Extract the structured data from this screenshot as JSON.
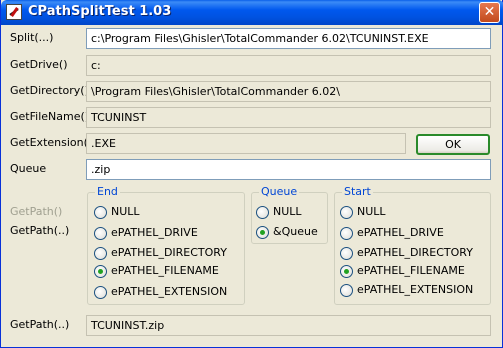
{
  "window": {
    "title": "CPathSplitTest 1.03",
    "close_glyph": "✕"
  },
  "fields": {
    "split": {
      "label": "Split(...)",
      "value": "c:\\Program Files\\Ghisler\\TotalCommander 6.02\\TCUNINST.EXE"
    },
    "drive": {
      "label": "GetDrive()",
      "value": "c:"
    },
    "directory": {
      "label": "GetDirectory()",
      "value": "\\Program Files\\Ghisler\\TotalCommander 6.02\\"
    },
    "filename": {
      "label": "GetFileName()",
      "value": "TCUNINST"
    },
    "extension": {
      "label": "GetExtension()",
      "value": ".EXE"
    },
    "queue": {
      "label": "Queue",
      "value": ".zip"
    }
  },
  "ok_button": "OK",
  "getpath_disabled_label": "GetPath()",
  "getpath_label": "GetPath(..)",
  "groups": {
    "end": {
      "title": "End",
      "options": [
        "NULL",
        "ePATHEL_DRIVE",
        "ePATHEL_DIRECTORY",
        "ePATHEL_FILENAME",
        "ePATHEL_EXTENSION"
      ],
      "selected": "ePATHEL_FILENAME"
    },
    "queue": {
      "title": "Queue",
      "options": [
        "NULL",
        "&Queue"
      ],
      "selected": "&Queue"
    },
    "start": {
      "title": "Start",
      "options": [
        "NULL",
        "ePATHEL_DRIVE",
        "ePATHEL_DIRECTORY",
        "ePATHEL_FILENAME",
        "ePATHEL_EXTENSION"
      ],
      "selected": "ePATHEL_FILENAME"
    }
  },
  "result": {
    "label": "GetPath(..)",
    "value": "TCUNINST.zip"
  },
  "colors": {
    "titlebar": "#0058EE",
    "face": "#ECE9D8",
    "group_title": "#0046D5",
    "radio_on": "#21A121"
  }
}
